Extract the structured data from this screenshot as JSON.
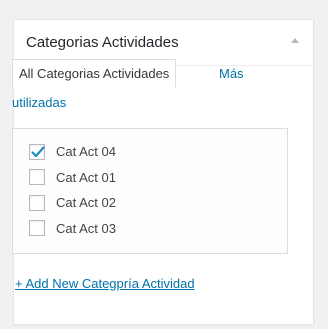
{
  "box": {
    "title": "Categorias Actividades",
    "toggle_icon": "arrow-up-icon"
  },
  "tabs": {
    "all": "All Categorias Actividades",
    "popular_line1": "Más",
    "popular_line2": "utilizadas"
  },
  "categories": [
    {
      "label": "Cat Act 04",
      "checked": true
    },
    {
      "label": "Cat Act 01",
      "checked": false
    },
    {
      "label": "Cat Act 02",
      "checked": false
    },
    {
      "label": "Cat Act 03",
      "checked": false
    }
  ],
  "add_new_link": "+ Add New Categpría Actividad",
  "colors": {
    "link": "#0073aa",
    "check": "#1e8cbe",
    "border": "#dddddd"
  }
}
